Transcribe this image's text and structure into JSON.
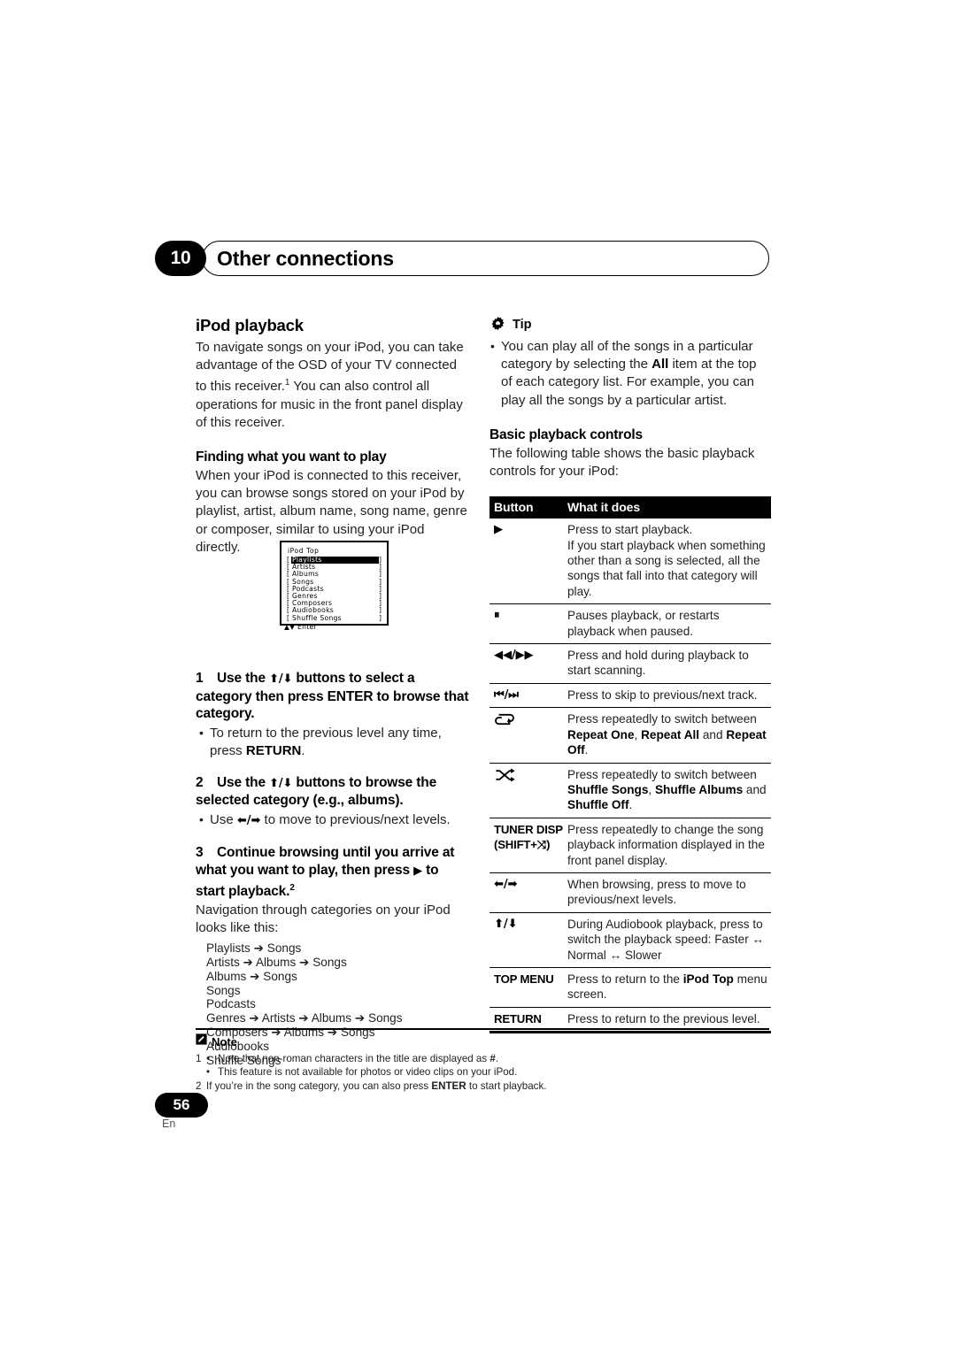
{
  "header": {
    "chapter_number": "10",
    "chapter_title": "Other connections"
  },
  "left_column": {
    "section_title": "iPod playback",
    "intro_paragraph": "To navigate songs on your iPod, you can take advantage of the OSD of your TV connected to this receiver.",
    "intro_footnote": "1",
    "intro_paragraph_cont": " You can also control all operations for music in the front panel display of this receiver.",
    "subsection_title": "Finding what you want to play",
    "subsection_paragraph": "When your iPod is connected to this receiver, you can browse songs stored on your iPod by playlist, artist, album name, song name, genre or composer, similar to using your iPod directly.",
    "ipod_screen": {
      "title": "iPod Top",
      "items": [
        "Playlists",
        "Artists",
        "Albums",
        "Songs",
        "Podcasts",
        "Genres",
        "Composers",
        "Audiobooks",
        "Shuffle Songs"
      ],
      "selected_index": 0,
      "footer": "▲▼ Enter",
      "bracket_left": "[",
      "bracket_right": "]"
    },
    "steps": [
      {
        "number": "1",
        "text_a": "Use the ",
        "glyph": "⬆/⬇",
        "text_b": " buttons to select a category then press ENTER to browse that category.",
        "bullets": [
          {
            "pre": "To return to the previous level any time, press ",
            "bold": "RETURN",
            "post": "."
          }
        ]
      },
      {
        "number": "2",
        "text_a": "Use the ",
        "glyph": "⬆/⬇",
        "text_b": " buttons to browse the selected category (e.g., albums).",
        "bullets": [
          {
            "pre": "Use ",
            "glyph": "⬅/➡",
            "post": " to move to previous/next levels."
          }
        ]
      },
      {
        "number": "3",
        "text_a": "Continue browsing until you arrive at what you want to play, then press ",
        "glyph": "▶",
        "text_b": " to start playback.",
        "footnote": "2"
      }
    ],
    "nav_intro": "Navigation through categories on your iPod looks like this:",
    "nav_paths": [
      "Playlists ➔ Songs",
      "Artists ➔ Albums ➔ Songs",
      "Albums ➔ Songs",
      "Songs",
      "Podcasts",
      "Genres ➔ Artists ➔ Albums ➔ Songs",
      "Composers ➔ Albums ➔ Songs",
      "Audiobooks",
      "Shuffle Songs"
    ]
  },
  "right_column": {
    "tip": {
      "label": "Tip",
      "icon": "gear-icon",
      "bullets": [
        {
          "pre": "You can play all of the songs in a particular category by selecting the ",
          "bold": "All",
          "post": " item at the top of each category list. For example, you can play all the songs by a particular artist."
        }
      ]
    },
    "basic_controls": {
      "title": "Basic playback controls",
      "intro": "The following table shows the basic playback controls for your iPod:",
      "table": {
        "headers": [
          "Button",
          "What it does"
        ],
        "rows": [
          {
            "button": "▶",
            "button_kind": "glyph",
            "lines": [
              "Press to start playback.",
              "If you start playback when something other than a song is selected, all the songs that fall into that category will play."
            ]
          },
          {
            "button": "⏸",
            "button_kind": "glyph",
            "lines": [
              "Pauses playback, or restarts playback when paused."
            ]
          },
          {
            "button": "◀◀/▶▶",
            "button_kind": "glyph",
            "lines": [
              "Press and hold during playback to start scanning."
            ]
          },
          {
            "button": "⏮/⏭",
            "button_kind": "glyph",
            "lines": [
              "Press to skip to previous/next track."
            ]
          },
          {
            "button": "↺",
            "button_kind": "repeat-icon",
            "lines": [
              "Press repeatedly to switch between "
            ],
            "rich": {
              "pre": "Press repeatedly to switch between ",
              "b1": "Repeat One",
              "mid1": ", ",
              "b2": "Repeat All",
              "mid2": " and ",
              "b3": "Repeat Off",
              "post": "."
            }
          },
          {
            "button": "⤨",
            "button_kind": "shuffle-icon",
            "rich": {
              "pre": "Press repeatedly to switch between ",
              "b1": "Shuffle Songs",
              "mid1": ", ",
              "b2": "Shuffle Albums",
              "mid2": " and ",
              "b3": "Shuffle Off",
              "post": "."
            }
          },
          {
            "button": "TUNER DISP",
            "button_sub": "(SHIFT+⤨)",
            "button_kind": "text",
            "lines": [
              "Press repeatedly to change the song playback information displayed in the front panel display."
            ]
          },
          {
            "button": "⬅/➡",
            "button_kind": "glyph",
            "lines": [
              "When browsing, press to move to previous/next levels."
            ]
          },
          {
            "button": "⬆/⬇",
            "button_kind": "glyph",
            "lines": [
              "During Audiobook playback, press to switch the playback speed: Faster ↔ Normal ↔ Slower"
            ]
          },
          {
            "button": "TOP MENU",
            "button_kind": "text",
            "rich2": {
              "pre": "Press to return to the ",
              "bold": "iPod Top",
              "post": " menu screen."
            }
          },
          {
            "button": "RETURN",
            "button_kind": "text",
            "lines": [
              "Press to return to the previous level."
            ]
          }
        ]
      }
    }
  },
  "footer": {
    "note_label": "Note",
    "note_icon": "pencil-icon",
    "notes": [
      {
        "number": "1",
        "bullet": "•",
        "text_pre": "Note that non-roman characters in the title are displayed as ",
        "bold": "#",
        "text_post": "."
      },
      {
        "number": "",
        "bullet": "•",
        "text_pre": "This feature is not available for photos or video clips on your iPod.",
        "bold": "",
        "text_post": ""
      },
      {
        "number": "2",
        "bullet": "",
        "text_pre": "If you’re in the song category, you can also press ",
        "bold": "ENTER",
        "text_post": " to start playback."
      }
    ],
    "page_number": "56",
    "language": "En"
  },
  "colors": {
    "ink": "#000000",
    "body_text": "#231f20",
    "page_bg": "#ffffff"
  }
}
